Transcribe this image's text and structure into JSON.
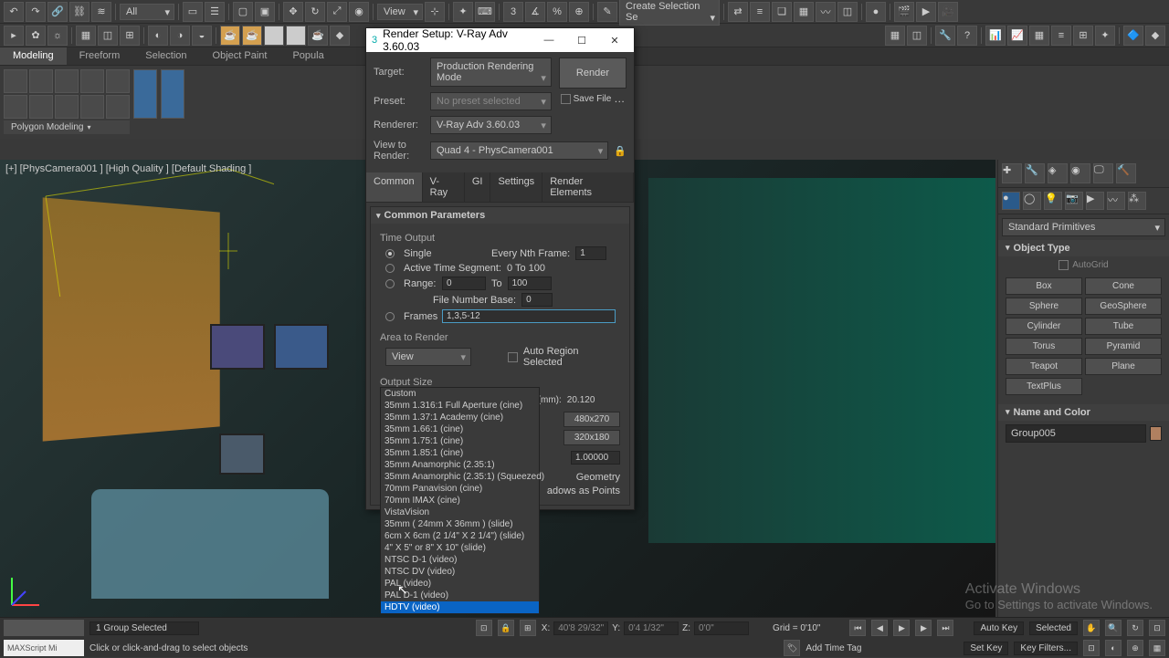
{
  "toolbar": {
    "dropdown1": "All",
    "view_dropdown": "View",
    "create_sel": "Create Selection Se"
  },
  "ribbon": {
    "tabs": [
      "Modeling",
      "Freeform",
      "Selection",
      "Object Paint",
      "Popula"
    ],
    "section": "Polygon Modeling"
  },
  "viewport": {
    "label": "[+] [PhysCamera001 ] [High Quality ] [Default Shading ]"
  },
  "dialog": {
    "title": "Render Setup: V-Ray Adv 3.60.03",
    "target_label": "Target:",
    "target_value": "Production Rendering Mode",
    "preset_label": "Preset:",
    "preset_value": "No preset selected",
    "renderer_label": "Renderer:",
    "renderer_value": "V-Ray Adv 3.60.03",
    "savefile_label": "Save File",
    "view_label": "View to Render:",
    "view_value": "Quad 4 - PhysCamera001",
    "render_btn": "Render",
    "tabs": [
      "Common",
      "V-Ray",
      "GI",
      "Settings",
      "Render Elements"
    ],
    "common_params": "Common Parameters",
    "time_output": "Time Output",
    "single": "Single",
    "every_nth": "Every Nth Frame:",
    "every_nth_val": "1",
    "active_seg": "Active Time Segment:",
    "active_seg_val": "0 To 100",
    "range": "Range:",
    "range_from": "0",
    "range_to_lbl": "To",
    "range_to": "100",
    "file_num_base": "File Number Base:",
    "file_num_val": "0",
    "frames": "Frames",
    "frames_val": "1,3,5-12",
    "area_render": "Area to Render",
    "area_value": "View",
    "auto_region": "Auto Region Selected",
    "output_size": "Output Size",
    "output_value": "HDTV (video)",
    "aperture": "Aperture Width(mm):",
    "aperture_val": "20.120",
    "preset_480": "480x270",
    "preset_320": "320x180",
    "pixel_aspect_val": "1.00000",
    "geometry": "Geometry",
    "shadows_points": "adows as Points"
  },
  "dropdown_options": [
    "Custom",
    "35mm 1.316:1 Full Aperture (cine)",
    "35mm 1.37:1 Academy (cine)",
    "35mm 1.66:1 (cine)",
    "35mm 1.75:1 (cine)",
    "35mm 1.85:1 (cine)",
    "35mm Anamorphic (2.35:1)",
    "35mm Anamorphic (2.35:1) (Squeezed)",
    "70mm Panavision (cine)",
    "70mm IMAX (cine)",
    "VistaVision",
    "35mm ( 24mm X 36mm ) (slide)",
    "6cm X 6cm (2 1/4\" X 2 1/4\") (slide)",
    "4\" X 5\" or 8\" X 10\" (slide)",
    "NTSC D-1 (video)",
    "NTSC DV (video)",
    "PAL (video)",
    "PAL D-1 (video)",
    "HDTV (video)"
  ],
  "command_panel": {
    "category": "Standard Primitives",
    "object_type": "Object Type",
    "autogrid": "AutoGrid",
    "buttons": [
      "Box",
      "Cone",
      "Sphere",
      "GeoSphere",
      "Cylinder",
      "Tube",
      "Torus",
      "Pyramid",
      "Teapot",
      "Plane",
      "TextPlus"
    ],
    "name_color": "Name and Color",
    "name_value": "Group005"
  },
  "status": {
    "selection": "1 Group Selected",
    "prompt": "Click or click-and-drag to select objects",
    "maxscript": "MAXScript Mi",
    "x_lbl": "X:",
    "x_val": "40'8 29/32\"",
    "y_lbl": "Y:",
    "y_val": "0'4 1/32\"",
    "z_lbl": "Z:",
    "z_val": "0'0\"",
    "grid": "Grid = 0'10\"",
    "add_time_tag": "Add Time Tag",
    "auto_key": "Auto Key",
    "set_key": "Set Key",
    "selected": "Selected",
    "key_filters": "Key Filters..."
  },
  "watermark": {
    "line1": "Activate Windows",
    "line2": "Go to Settings to activate Windows."
  }
}
